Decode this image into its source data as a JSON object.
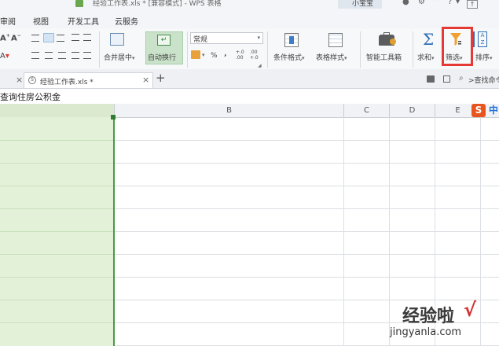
{
  "title_bar": {
    "text": "经验工作表.xls * [兼容模式] - WPS 表格",
    "user": "小宝宝"
  },
  "menu": {
    "items": [
      "审阅",
      "视图",
      "开发工具",
      "云服务"
    ]
  },
  "ribbon": {
    "merge_label": "合并居中",
    "wrap_label": "自动换行",
    "format_value": "常规",
    "cond_format_label": "条件格式",
    "table_style_label": "表格样式",
    "smart_toolbox_label": "智能工具箱",
    "sum_label": "求和",
    "filter_label": "筛选",
    "sort_label": "排序",
    "percent": "%",
    "comma": "‚",
    "inc_decimal": "+.0 .00",
    "dec_decimal": ".00 +.0",
    "font_a": "A",
    "highlight_color": "#e53935"
  },
  "tabs": {
    "doc_name": "经验工作表.xls *",
    "add": "+",
    "close": "×",
    "search_placeholder": "查找命令"
  },
  "formula": {
    "content": "查询住房公积金"
  },
  "columns": [
    "B",
    "C",
    "D",
    "E"
  ],
  "sougou": {
    "brand": "S",
    "label": "中"
  },
  "watermark": {
    "line1": "经验啦",
    "check": "√",
    "line2": "jingyanla.com"
  }
}
